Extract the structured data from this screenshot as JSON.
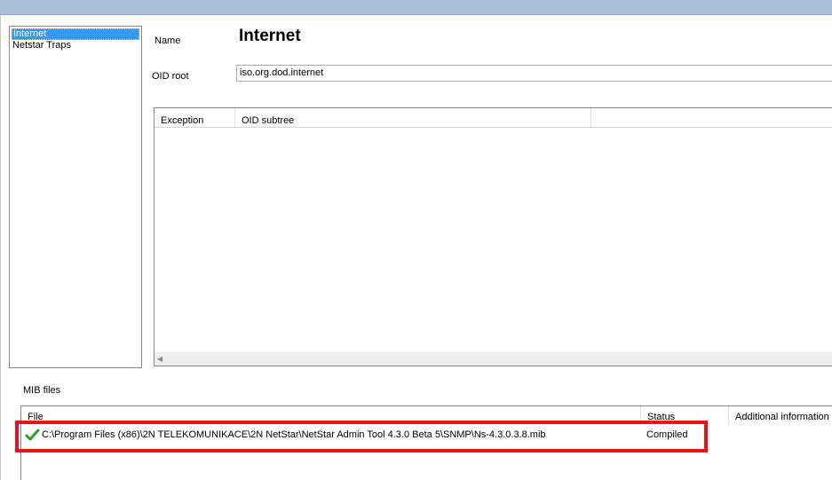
{
  "tree": {
    "items": [
      {
        "label": "Internet",
        "selected": true
      },
      {
        "label": "Netstar Traps",
        "selected": false
      }
    ]
  },
  "form": {
    "name_label": "Name",
    "name_value": "Internet",
    "oid_root_label": "OID root",
    "oid_root_value": "iso.org.dod.internet"
  },
  "exceptions_table": {
    "columns": [
      "Exception",
      "OID subtree"
    ],
    "rows": []
  },
  "mib": {
    "section_label": "MIB files",
    "columns": [
      "File",
      "Status",
      "Additional information"
    ],
    "rows": [
      {
        "status_icon": "checkmark-icon",
        "file": "C:\\Program Files (x86)\\2N TELEKOMUNIKACE\\2N NetStar\\NetStar Admin Tool 4.3.0 Beta 5\\SNMP\\Ns-4.3.0.3.8.mib",
        "status": "Compiled",
        "info": ""
      }
    ]
  },
  "colors": {
    "selection": "#3399ff",
    "highlight": "#e3141a",
    "check": "#2e9a2e",
    "titlebar": "#a9bfd8"
  }
}
